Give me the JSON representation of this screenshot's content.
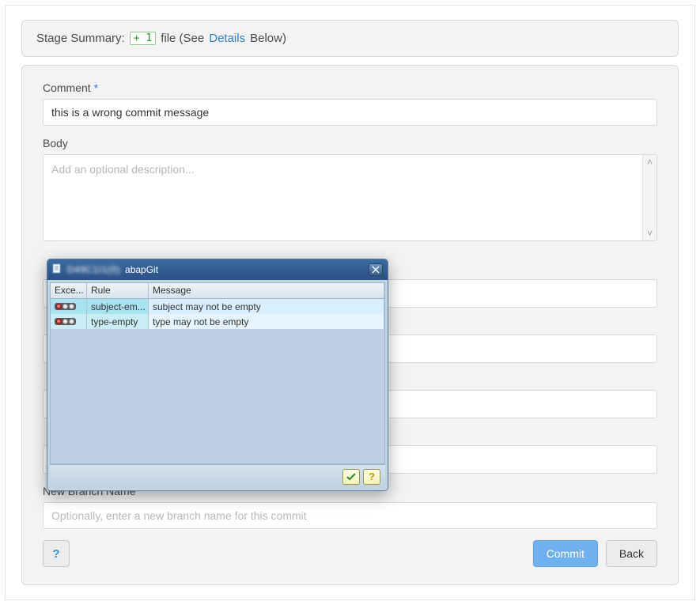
{
  "summary": {
    "prefix": "Stage Summary:",
    "delta": "+ 1",
    "file_word": "file (See",
    "details_link": "Details",
    "suffix": "Below)"
  },
  "form": {
    "comment_label": "Comment",
    "comment_value": "this is a wrong commit message",
    "body_label": "Body",
    "body_placeholder": "Add an optional description...",
    "new_branch_label": "New Branch Name",
    "new_branch_placeholder": "Optionally, enter a new branch name for this commit"
  },
  "buttons": {
    "commit": "Commit",
    "back": "Back"
  },
  "dialog": {
    "title_obscured": "D49C1I1(0)",
    "title_app": "abapGit",
    "columns": {
      "exc": "Exce...",
      "rule": "Rule",
      "msg": "Message"
    },
    "rows": [
      {
        "rule": "subject-em...",
        "message": "subject may not be empty"
      },
      {
        "rule": "type-empty",
        "message": "type may not be empty"
      }
    ]
  }
}
